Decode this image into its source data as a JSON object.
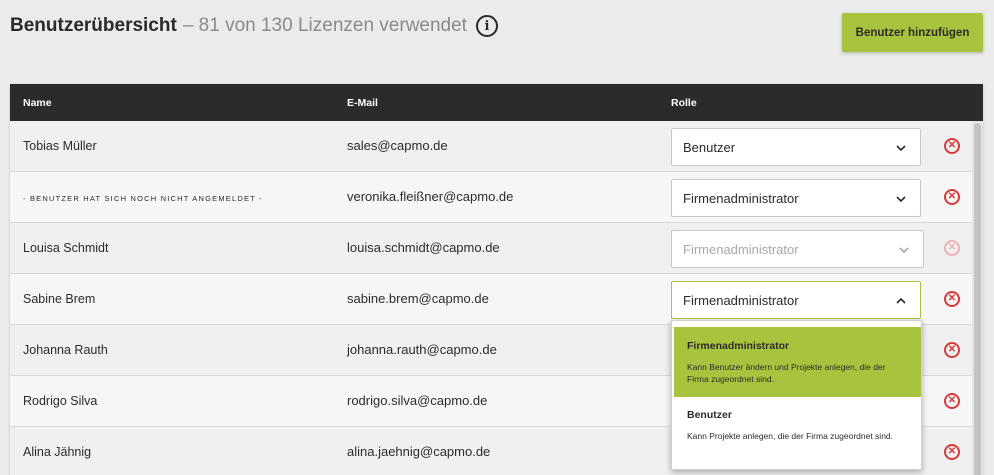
{
  "header": {
    "title": "Benutzerübersicht",
    "subtitle": "– 81 von 130 Lizenzen verwendet",
    "info_icon": "info-circle-icon",
    "add_button_label": "Benutzer hinzufügen"
  },
  "table": {
    "columns": {
      "name": "Name",
      "email": "E-Mail",
      "role": "Rolle"
    },
    "rows": [
      {
        "name": "Tobias Müller",
        "email": "sales@capmo.de",
        "role": "Benutzer"
      },
      {
        "name": "- Benutzer hat sich noch nicht angemeldet -",
        "email": "veronika.fleißner@capmo.de",
        "role": "Firmenadministrator"
      },
      {
        "name": "Louisa Schmidt",
        "email": "louisa.schmidt@capmo.de",
        "role": "Firmenadministrator"
      },
      {
        "name": "Sabine Brem",
        "email": "sabine.brem@capmo.de",
        "role": "Firmenadministrator"
      },
      {
        "name": "Johanna Rauth",
        "email": "johanna.rauth@capmo.de",
        "role": ""
      },
      {
        "name": "Rodrigo Silva",
        "email": "rodrigo.silva@capmo.de",
        "role": ""
      },
      {
        "name": "Alina Jähnig",
        "email": "alina.jaehnig@capmo.de",
        "role": ""
      }
    ]
  },
  "dropdown": {
    "options": [
      {
        "title": "Firmenadministrator",
        "description": "Kann Benutzer ändern und Projekte anlegen, die der Firma zugeordnet sind."
      },
      {
        "title": "Benutzer",
        "description": "Kann Projekte anlegen, die der Firma zugeordnet sind."
      }
    ]
  },
  "colors": {
    "accent": "#a8c43f",
    "danger": "#d33b3b",
    "header_bg": "#2b2b2b"
  }
}
